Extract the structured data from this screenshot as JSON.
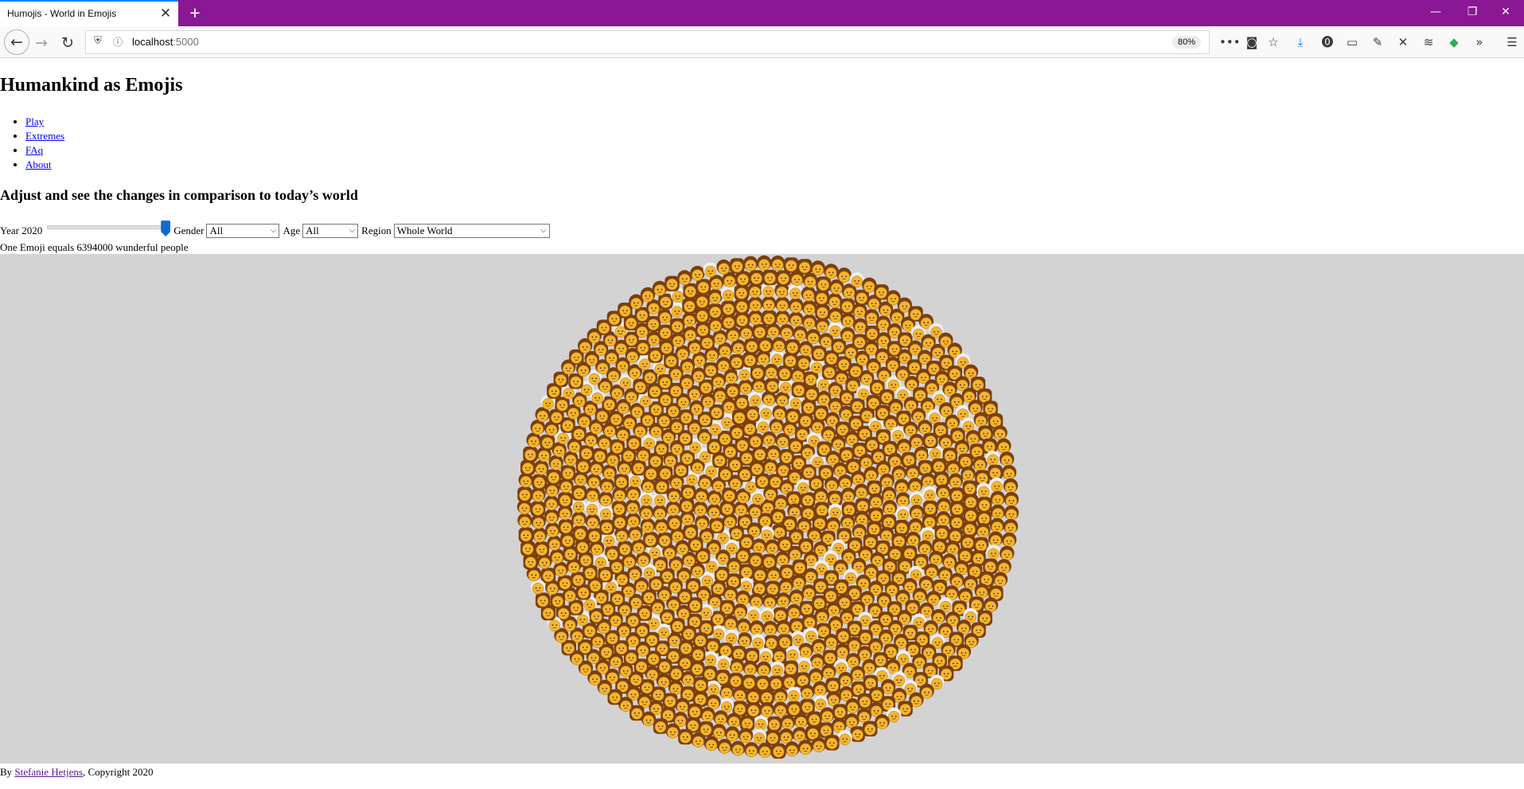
{
  "browser": {
    "tab_title": "Humojis - World in Emojis",
    "tab_close": "✕",
    "new_tab": "+",
    "url_host": "localhost",
    "url_port": ":5000",
    "zoom": "80%",
    "window_controls": {
      "minimize": "—",
      "restore": "❐",
      "close": "✕"
    },
    "toolbar_icons": [
      "more-icon",
      "pocket-icon",
      "bookmark-star-icon",
      "download-icon",
      "password-icon",
      "synced-tabs-icon",
      "eyedropper-icon",
      "x-extension-icon",
      "layers-icon",
      "green-extension-icon",
      "overflow-icon",
      "menu-icon"
    ]
  },
  "page": {
    "title": "Humankind as Emojis",
    "nav": [
      "Play",
      "Extremes",
      "FAq",
      "About"
    ],
    "subtitle": "Adjust and see the changes in comparison to today’s world",
    "controls": {
      "year_label": "Year 2020",
      "year_slider_fraction": 1.0,
      "gender_label": "Gender",
      "gender_value": "All",
      "age_label": "Age",
      "age_value": "All",
      "region_label": "Region",
      "region_value": "Whole World"
    },
    "info_text": "One Emoji equals 6394000 wunderful people",
    "visualization": {
      "background": "#d3d3d3",
      "skin_color": "#f5b52e",
      "hair_color": "#7a3f0f",
      "elderly_hair_color": "#eeeeee"
    },
    "footer": {
      "prefix": "By ",
      "author": "Stefanie Hetjens",
      "suffix": ", Copyright 2020"
    }
  }
}
